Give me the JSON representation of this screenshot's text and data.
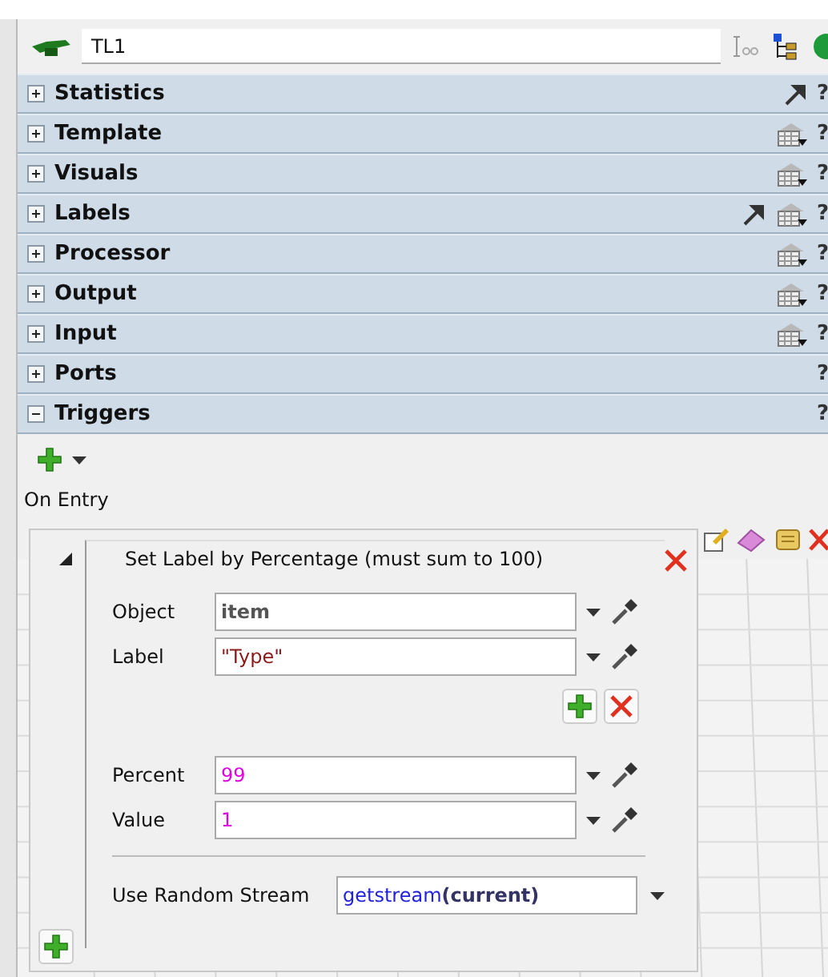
{
  "object": {
    "name": "TL1"
  },
  "sections": [
    {
      "title": "Statistics",
      "expanded": false,
      "link_button": true,
      "table_menu": false,
      "help": "?"
    },
    {
      "title": "Template",
      "expanded": false,
      "link_button": false,
      "table_menu": true,
      "help": "?"
    },
    {
      "title": "Visuals",
      "expanded": false,
      "link_button": false,
      "table_menu": true,
      "help": "?"
    },
    {
      "title": "Labels",
      "expanded": false,
      "link_button": true,
      "table_menu": true,
      "help": "?"
    },
    {
      "title": "Processor",
      "expanded": false,
      "link_button": false,
      "table_menu": true,
      "help": "?"
    },
    {
      "title": "Output",
      "expanded": false,
      "link_button": false,
      "table_menu": true,
      "help": "?"
    },
    {
      "title": "Input",
      "expanded": false,
      "link_button": false,
      "table_menu": true,
      "help": "?"
    },
    {
      "title": "Ports",
      "expanded": false,
      "link_button": false,
      "table_menu": false,
      "help": "?"
    },
    {
      "title": "Triggers",
      "expanded": true,
      "link_button": false,
      "table_menu": false,
      "help": "?"
    }
  ],
  "triggers": {
    "event": "On Entry",
    "action": {
      "title": "Set Label by Percentage (must sum to 100)",
      "expanded": true,
      "fields": [
        {
          "label": "Object",
          "value": "item",
          "kind": "keyword"
        },
        {
          "label": "Label",
          "value": "\"Type\"",
          "kind": "string"
        }
      ],
      "percent_fields": [
        {
          "label": "Percent",
          "value": "99",
          "kind": "number"
        },
        {
          "label": "Value",
          "value": "1",
          "kind": "number"
        }
      ],
      "stream": {
        "label": "Use Random Stream",
        "value": "getstream**(current)**"
      }
    }
  }
}
